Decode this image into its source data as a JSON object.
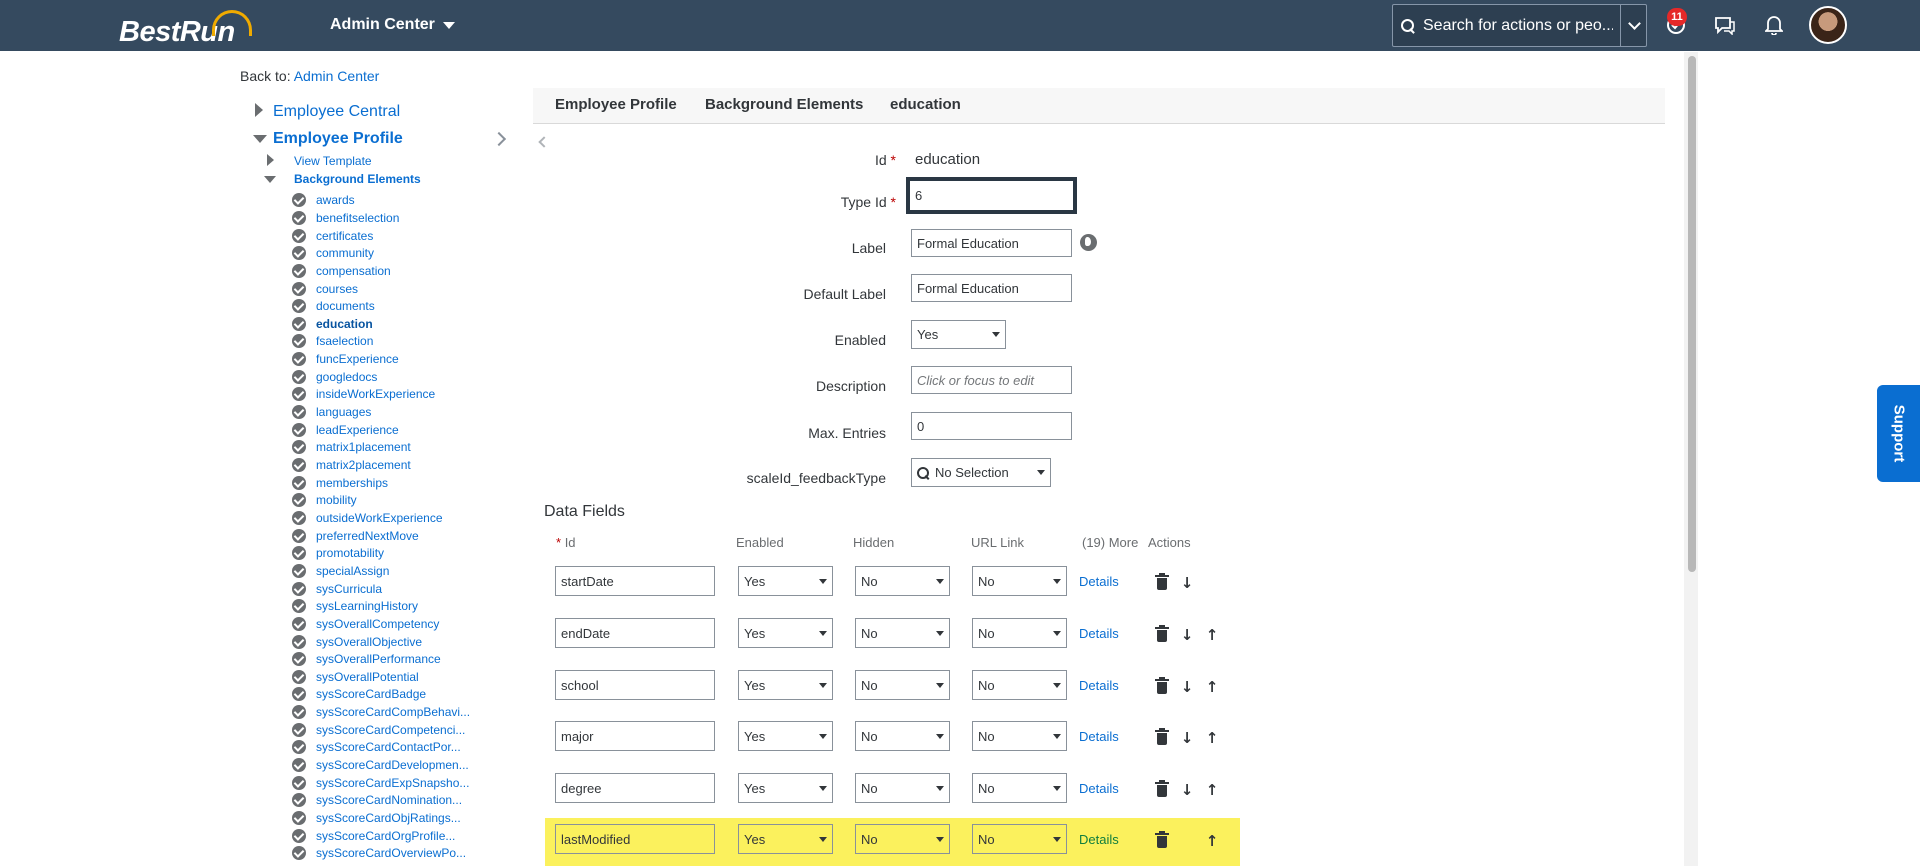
{
  "shell": {
    "logo": "BestRun",
    "app_title": "Admin Center",
    "search_placeholder": "Search for actions or peo...",
    "notification_count": "11",
    "icons": [
      "todo-icon",
      "feedback-icon",
      "bell-icon"
    ]
  },
  "back": {
    "prefix": "Back to:",
    "link": "Admin Center"
  },
  "tree": {
    "root1": "Employee Central",
    "root2": "Employee Profile",
    "sub1": "View Template",
    "sub2": "Background Elements",
    "leaves": [
      "awards",
      "benefitselection",
      "certificates",
      "community",
      "compensation",
      "courses",
      "documents",
      "education",
      "fsaelection",
      "funcExperience",
      "googledocs",
      "insideWorkExperience",
      "languages",
      "leadExperience",
      "matrix1placement",
      "matrix2placement",
      "memberships",
      "mobility",
      "outsideWorkExperience",
      "preferredNextMove",
      "promotability",
      "specialAssign",
      "sysCurricula",
      "sysLearningHistory",
      "sysOverallCompetency",
      "sysOverallObjective",
      "sysOverallPerformance",
      "sysOverallPotential",
      "sysScoreCardBadge",
      "sysScoreCardCompBehavi...",
      "sysScoreCardCompetenci...",
      "sysScoreCardContactPor...",
      "sysScoreCardDevelopmen...",
      "sysScoreCardExpSnapsho...",
      "sysScoreCardNomination...",
      "sysScoreCardObjRatings...",
      "sysScoreCardOrgProfile...",
      "sysScoreCardOverviewPo..."
    ],
    "active": "education"
  },
  "breadcrumb": [
    "Employee Profile",
    "Background Elements",
    "education"
  ],
  "form": {
    "id_label": "Id",
    "id_value": "education",
    "type_id_label": "Type Id",
    "type_id_value": "6",
    "label_label": "Label",
    "label_value": "Formal Education",
    "default_label_label": "Default Label",
    "default_label_value": "Formal Education",
    "enabled_label": "Enabled",
    "enabled_value": "Yes",
    "description_label": "Description",
    "description_placeholder": "Click or focus to edit",
    "max_entries_label": "Max. Entries",
    "max_entries_value": "0",
    "scale_label": "scaleId_feedbackType",
    "scale_value": "No Selection",
    "required_mark": "*"
  },
  "data_fields": {
    "title": "Data Fields",
    "headers": {
      "id": "Id",
      "enabled": "Enabled",
      "hidden": "Hidden",
      "url": "URL Link",
      "more": "(19) More",
      "actions": "Actions"
    },
    "details_label": "Details",
    "rows": [
      {
        "id": "startDate",
        "enabled": "Yes",
        "hidden": "No",
        "url": "No"
      },
      {
        "id": "endDate",
        "enabled": "Yes",
        "hidden": "No",
        "url": "No"
      },
      {
        "id": "school",
        "enabled": "Yes",
        "hidden": "No",
        "url": "No"
      },
      {
        "id": "major",
        "enabled": "Yes",
        "hidden": "No",
        "url": "No"
      },
      {
        "id": "degree",
        "enabled": "Yes",
        "hidden": "No",
        "url": "No"
      },
      {
        "id": "lastModified",
        "enabled": "Yes",
        "hidden": "No",
        "url": "No"
      }
    ]
  },
  "support": "Support",
  "colors": {
    "shell": "#354a5f",
    "link": "#0a6ed1",
    "highlight": "#fbf15d",
    "support": "#0a6ed1"
  }
}
